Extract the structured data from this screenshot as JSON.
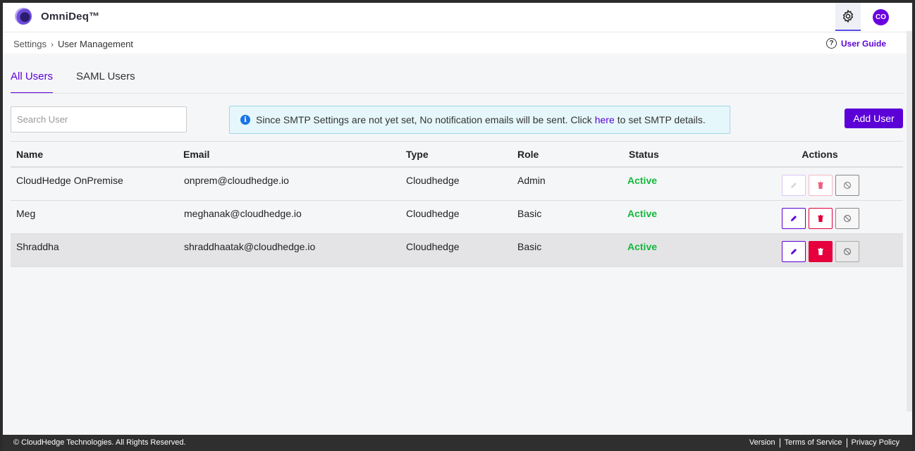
{
  "app": {
    "brand": "OmniDeq™",
    "avatar_initials": "CO",
    "accent": "#5b00d6"
  },
  "breadcrumb": {
    "root": "Settings",
    "separator": "›",
    "current": "User Management"
  },
  "user_guide": {
    "label": "User Guide",
    "icon": "help-circle-icon"
  },
  "tabs": [
    {
      "label": "All Users",
      "active": true
    },
    {
      "label": "SAML Users",
      "active": false
    }
  ],
  "search": {
    "placeholder": "Search User",
    "value": ""
  },
  "alert": {
    "text_before": "Since SMTP Settings are not yet set, No notification emails will be sent. Click",
    "link": "here",
    "text_after": "to set SMTP details."
  },
  "add_user_label": "Add User",
  "table": {
    "headers": {
      "name": "Name",
      "email": "Email",
      "type": "Type",
      "role": "Role",
      "status": "Status",
      "actions": "Actions"
    },
    "rows": [
      {
        "name": "CloudHedge OnPremise",
        "email": "onprem@cloudhedge.io",
        "type": "Cloudhedge",
        "role": "Admin",
        "status": "Active"
      },
      {
        "name": "Meg",
        "email": "meghanak@cloudhedge.io",
        "type": "Cloudhedge",
        "role": "Basic",
        "status": "Active"
      },
      {
        "name": "Shraddha",
        "email": "shraddhaatak@cloudhedge.io",
        "type": "Cloudhedge",
        "role": "Basic",
        "status": "Active"
      }
    ]
  },
  "footer": {
    "copyright": "© CloudHedge Technologies. All Rights Reserved.",
    "links": [
      "Version",
      "Terms of Service",
      "Privacy Policy"
    ]
  }
}
